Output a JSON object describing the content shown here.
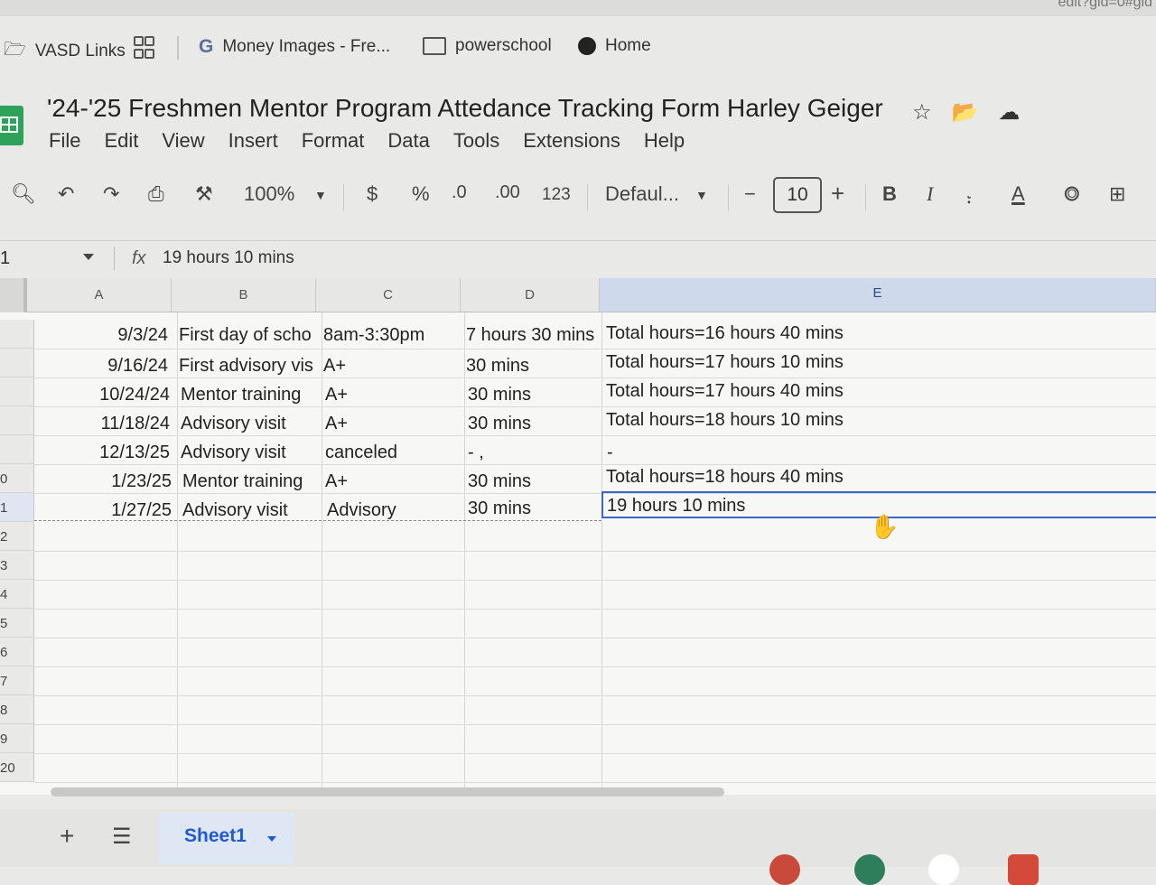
{
  "browser": {
    "url_fragment": "edit?gid=0#gid",
    "bookmarks": [
      {
        "label": "VASD Links",
        "icon": "shared-folder-icon"
      },
      {
        "label": "",
        "icon": "apps-grid-icon"
      },
      {
        "label": "Money Images - Fre...",
        "icon": "google-g-icon"
      },
      {
        "label": "powerschool",
        "icon": "folder-icon"
      },
      {
        "label": "Home",
        "icon": "globe-icon"
      }
    ]
  },
  "document": {
    "title": "'24-'25 Freshmen Mentor Program Attedance Tracking Form Harley Geiger",
    "menu": [
      "File",
      "Edit",
      "View",
      "Insert",
      "Format",
      "Data",
      "Tools",
      "Extensions",
      "Help"
    ]
  },
  "toolbar": {
    "zoom": "100%",
    "currency": "$",
    "percent": "%",
    "decrease_decimal": ".0",
    "increase_decimal": ".00",
    "number_format": "123",
    "font": "Defaul...",
    "font_size": "10",
    "minus": "−",
    "plus": "+",
    "bold": "B",
    "italic": "I",
    "text_color": "A"
  },
  "formula_bar": {
    "cell_ref": "1",
    "fx": "fx",
    "value": "19 hours 10 mins"
  },
  "grid": {
    "columns": [
      "A",
      "B",
      "C",
      "D",
      "E"
    ],
    "row_numbers": [
      "",
      "",
      "",
      "",
      "",
      "0",
      "1",
      "2",
      "3",
      "4",
      "5",
      "6",
      "7",
      "8",
      "9",
      "20"
    ],
    "rows": [
      {
        "a": "9/3/24",
        "b": "First day of scho",
        "c": "8am-3:30pm",
        "d": "7 hours 30 mins",
        "e": "Total hours=16 hours 40 mins"
      },
      {
        "a": "9/16/24",
        "b": "First advisory vis",
        "c": "A+",
        "d": "30 mins",
        "e": "Total hours=17 hours 10 mins"
      },
      {
        "a": "10/24/24",
        "b": "Mentor training",
        "c": "A+",
        "d": "30 mins",
        "e": "Total hours=17 hours 40 mins"
      },
      {
        "a": "11/18/24",
        "b": "Advisory visit",
        "c": "A+",
        "d": "30 mins",
        "e": "Total hours=18 hours 10 mins"
      },
      {
        "a": "12/13/25",
        "b": "Advisory visit",
        "c": "canceled",
        "d": "- ,",
        "e": "-"
      },
      {
        "a": "1/23/25",
        "b": "Mentor training",
        "c": "A+",
        "d": "30 mins",
        "e": "Total hours=18 hours 40 mins"
      },
      {
        "a": "1/27/25",
        "b": "Advisory visit",
        "c": "Advisory",
        "d": "30 mins",
        "e": "19 hours 10 mins"
      }
    ]
  },
  "sheets": {
    "add": "+",
    "tabs": [
      {
        "label": "Sheet1"
      }
    ]
  },
  "colors": {
    "selection_border": "#3b67c4",
    "selected_header": "#cfd9ec",
    "sheets_green": "#2fa25a",
    "active_tab_text": "#1f5ad1"
  }
}
